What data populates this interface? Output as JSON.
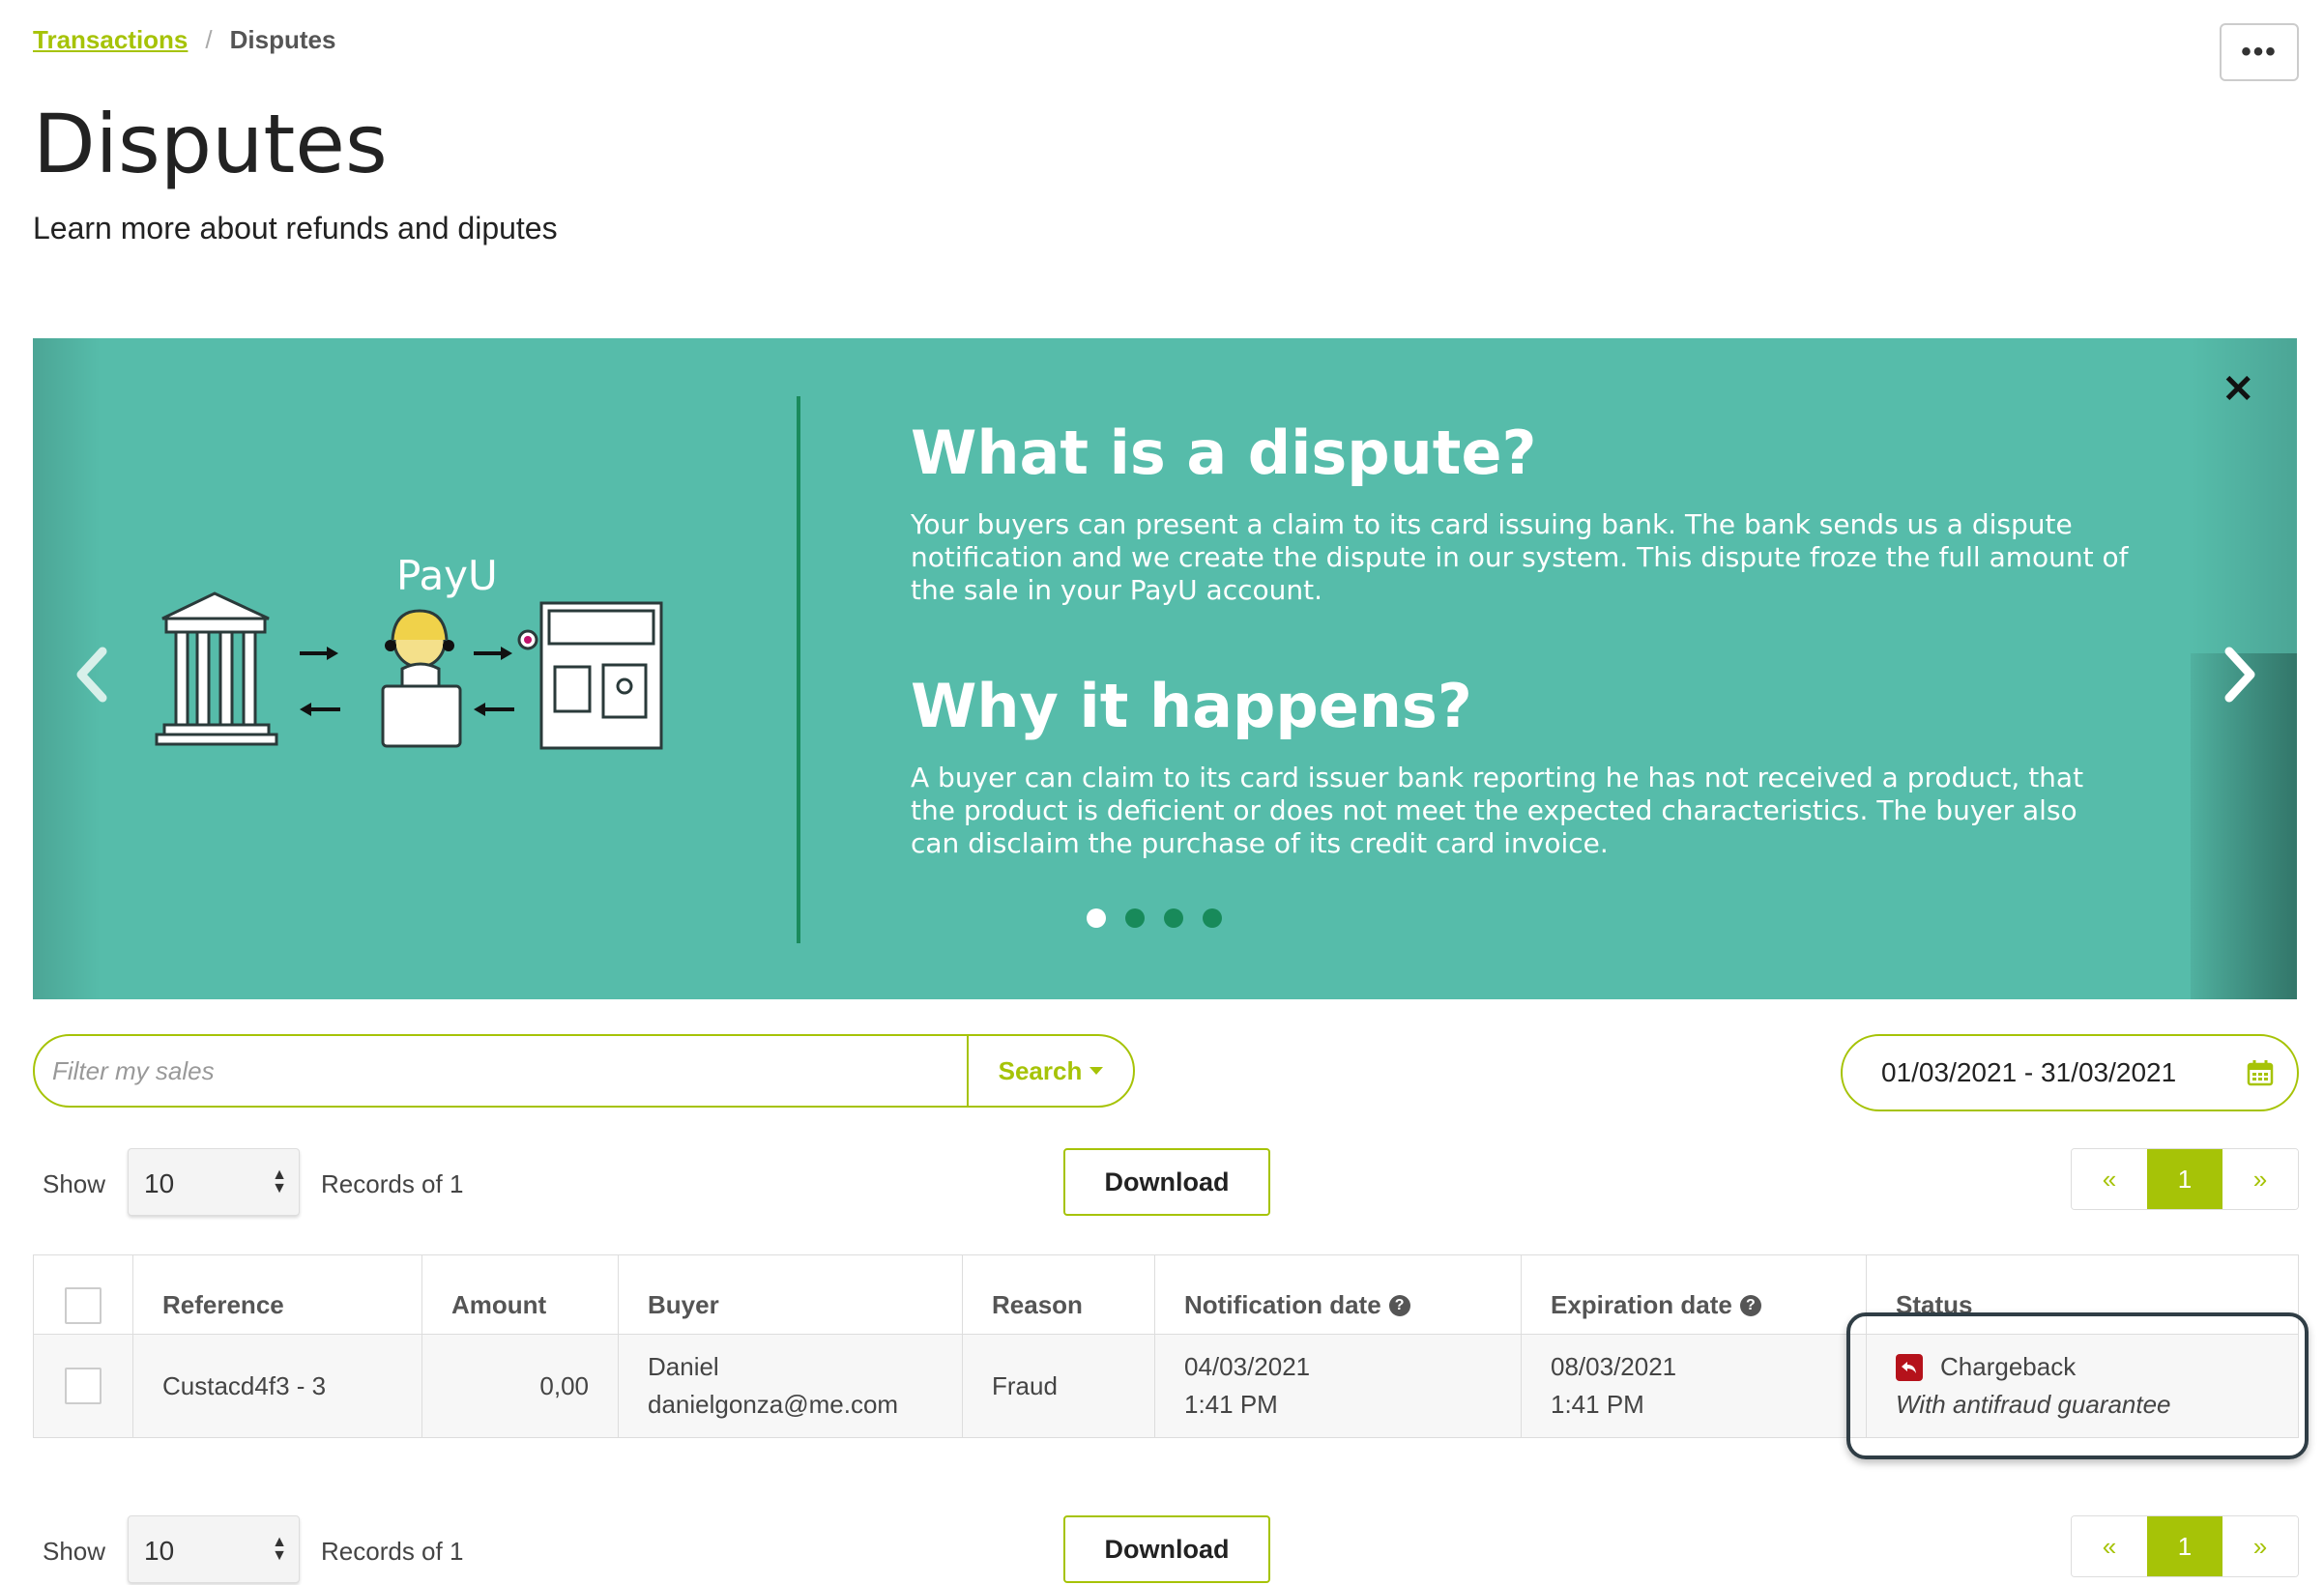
{
  "breadcrumb": {
    "parent": "Transactions",
    "separator": "/",
    "current": "Disputes"
  },
  "header": {
    "more_label": "•••",
    "title": "Disputes",
    "subtitle": "Learn more about refunds and diputes"
  },
  "banner": {
    "close": "✕",
    "brand": "PayU",
    "heading1": "What is a dispute?",
    "text1": "Your buyers can present a claim to its card issuing bank. The bank sends us a dispute notification and we create the dispute in our system. This dispute froze the full amount of the sale in your PayU account.",
    "heading2": "Why it happens?",
    "text2": "A buyer can claim to its card issuer bank reporting he has not received a product, that the product is deficient or does not meet the expected characteristics. The buyer also can disclaim the purchase of its credit card invoice.",
    "slides": 4,
    "active_slide": 1,
    "colors": {
      "background": "#56bcaa",
      "divider": "#1a8a5c",
      "dot": "#188a5a"
    }
  },
  "filter": {
    "placeholder": "Filter my sales",
    "value": "",
    "search_label": "Search"
  },
  "date_range": "01/03/2021 - 31/03/2021",
  "controls": {
    "show_label": "Show",
    "page_size": "10",
    "records_label": "Records of 1",
    "download_label": "Download",
    "pager": {
      "prev": "«",
      "page": "1",
      "next": "»"
    }
  },
  "table": {
    "headers": {
      "reference": "Reference",
      "amount": "Amount",
      "buyer": "Buyer",
      "reason": "Reason",
      "notification": "Notification date",
      "expiration": "Expiration date",
      "status": "Status"
    },
    "rows": [
      {
        "reference": "Custacd4f3 - 3",
        "amount": "0,00",
        "buyer_name": "Daniel",
        "buyer_email": "danielgonza@me.com",
        "reason": "Fraud",
        "notification_date": "04/03/2021",
        "notification_time": "1:41 PM",
        "expiration_date": "08/03/2021",
        "expiration_time": "1:41 PM",
        "status": "Chargeback",
        "status_note": "With antifraud guarantee"
      }
    ]
  },
  "accent_color": "#a6c307",
  "status_color": "#b5121b"
}
